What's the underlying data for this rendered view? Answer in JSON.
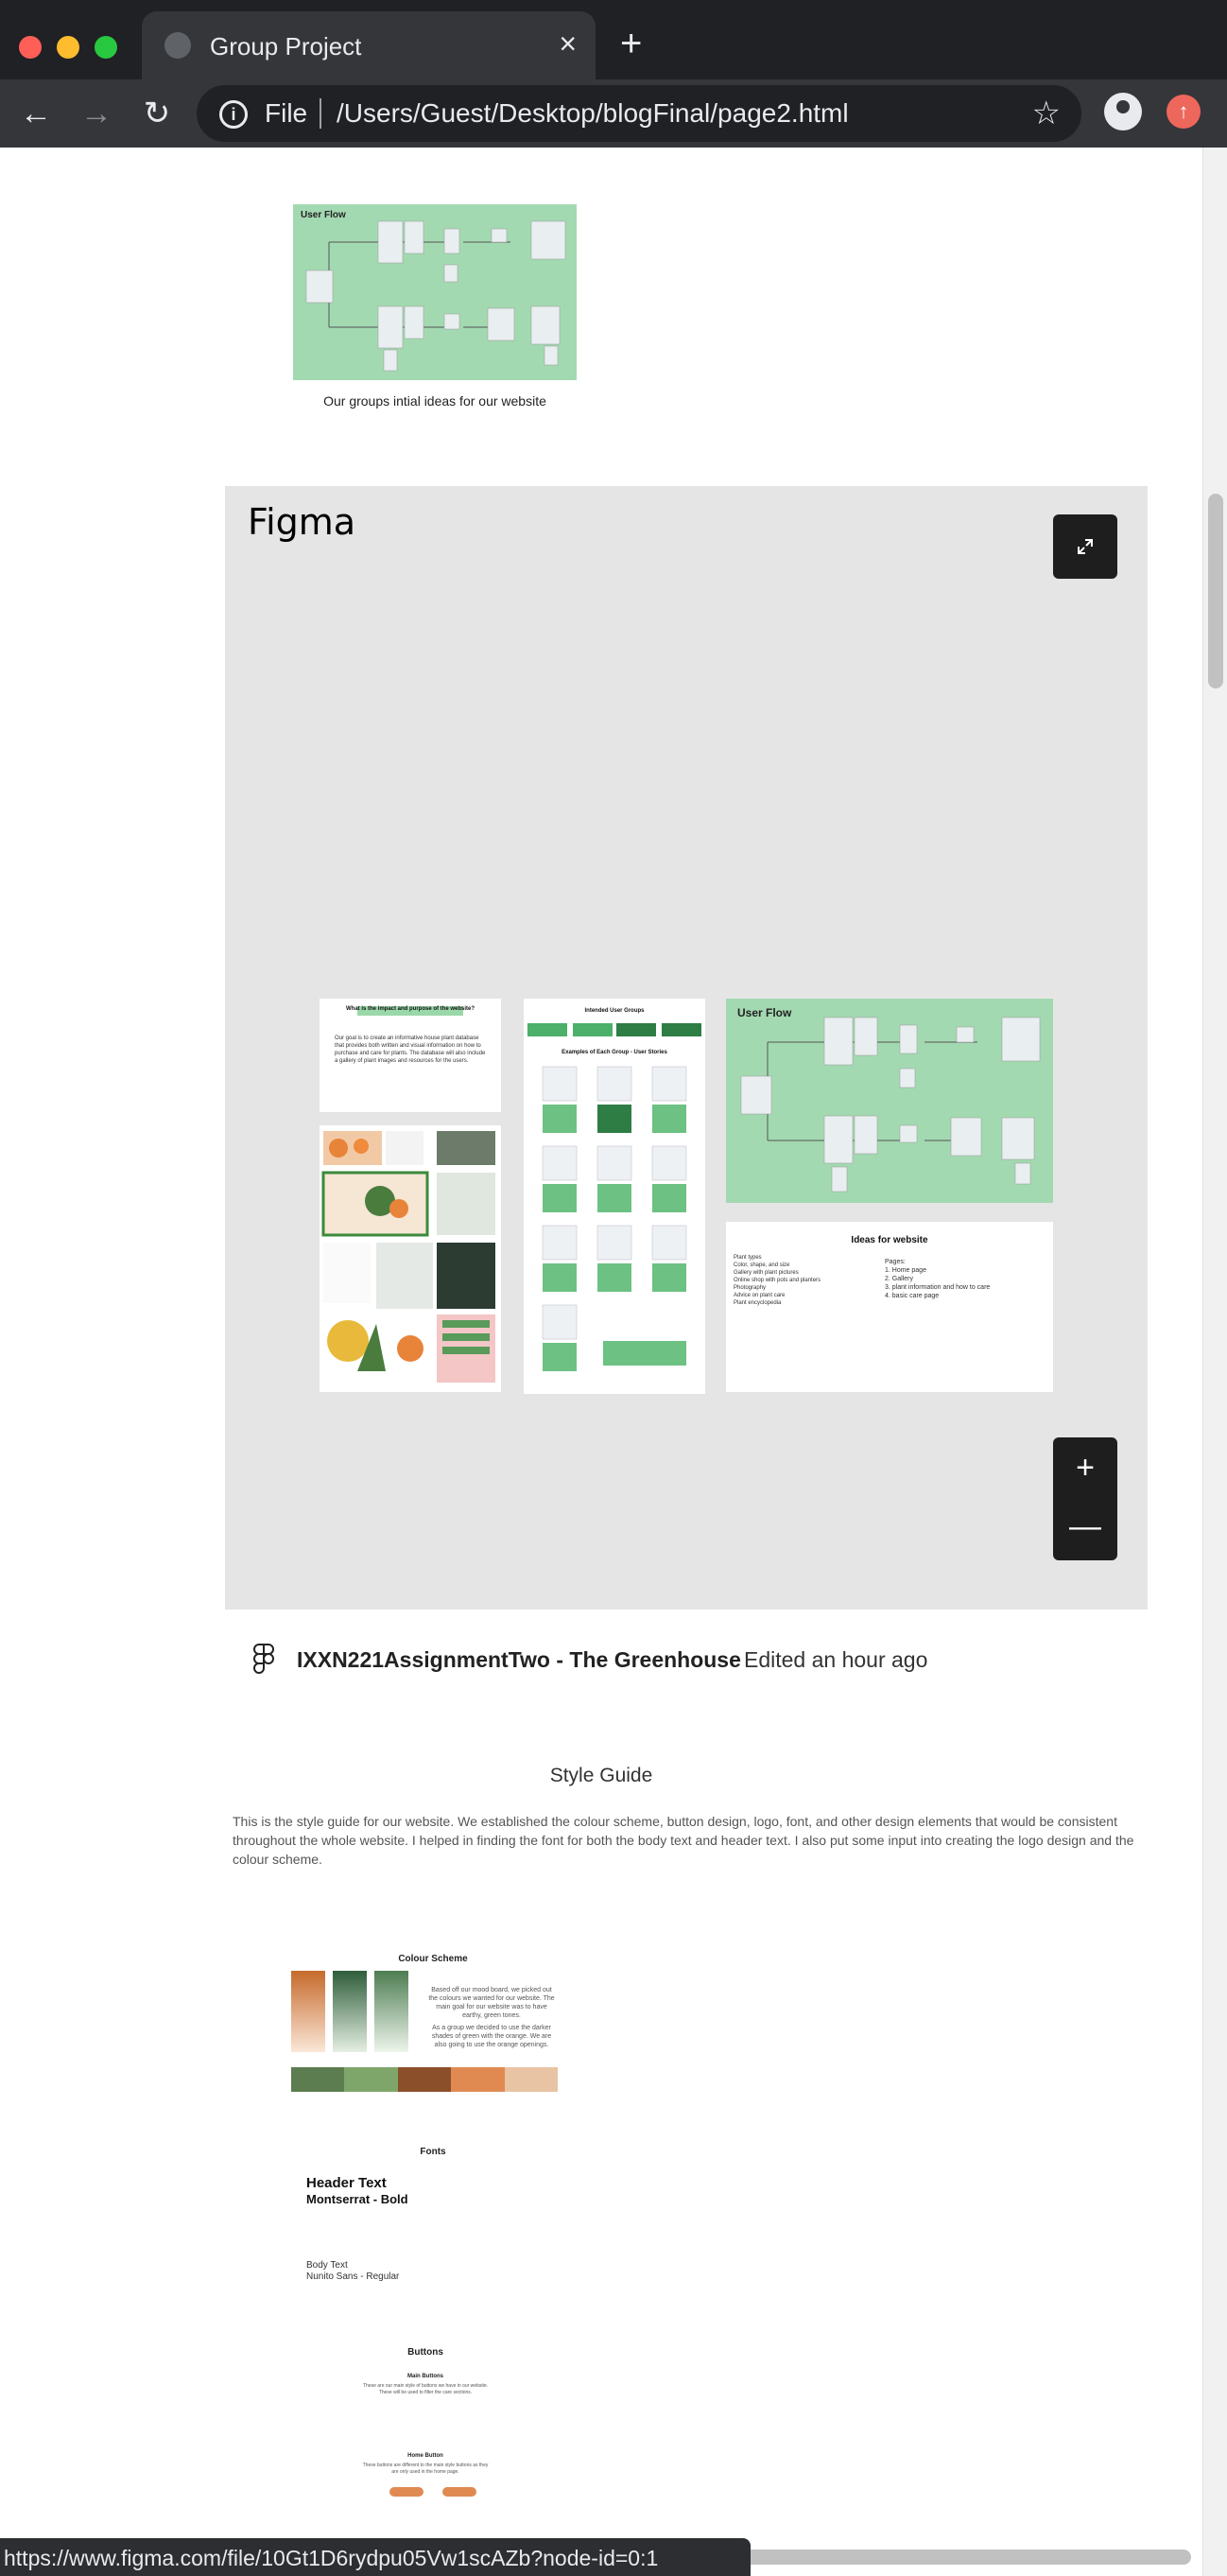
{
  "browser": {
    "tab_title": "Group Project",
    "close_tab_glyph": "×",
    "new_tab_glyph": "+",
    "back_glyph": "←",
    "forward_glyph": "→",
    "reload_glyph": "↻",
    "info_glyph": "i",
    "scheme_label": "File",
    "url": "/Users/Guest/Desktop/blogFinal/page2.html",
    "bookmark_glyph": "☆",
    "update_glyph": "↑",
    "traffic_colors": [
      "#ff5f57",
      "#febc2e",
      "#28c840"
    ]
  },
  "page": {
    "flow_image": {
      "title": "User Flow",
      "caption": "Our groups intial ideas for our website"
    },
    "figma_embed": {
      "logo": "Figma",
      "zoom_in": "+",
      "zoom_out": "—",
      "frames": {
        "purpose_title": "What is the impact and purpose of the website?",
        "purpose_body": "Our goal is to create an informative house plant database that provides both written and visual information on how to purchase and care for plants. The database will also include a gallery of plant images and resources for the users.",
        "user_groups_title": "Intended User Groups",
        "user_groups_subtitle": "Examples of Each Group - User Stories",
        "flow_title": "User Flow",
        "ideas_title": "Ideas for website",
        "ideas_left": "Plant types\nColor, shape, and size\nGallery with plant pictures\nOnline shop with pots and planters\nPhotography\nAdvice on plant care\nPlant encyclopedia",
        "ideas_right": "Pages:\n1. Home page\n2. Gallery\n3. plant information and how to care\n4. basic care page"
      },
      "file_name": "IXXN221AssignmentTwo - The Greenhouse",
      "edited": "Edited an hour ago"
    },
    "style_guide": {
      "title": "Style Guide",
      "body": "This is the style guide for our website. We established the colour scheme, button design, logo, font, and other design elements that would be consistent throughout the whole website. I helped in finding the font for both the body text and header text. I also put some input into creating the logo design and the colour scheme.",
      "image": {
        "colour_heading": "Colour Scheme",
        "colour_note": "Based off our mood board, we picked out the colours we wanted for our website. The main goal for our website was to have earthy, green tones.",
        "colour_note2": "As a group we decided to use the darker shades of green with the orange. We are also going to use the orange openings.",
        "swatches": [
          "#5c7d4f",
          "#7fa66a",
          "#8b4f2a",
          "#e08a52",
          "#e8c4a4"
        ],
        "fonts_heading": "Fonts",
        "header_text_label": "Header Text",
        "header_font": "Montserrat - Bold",
        "body_text_label": "Body Text",
        "body_font": "Nunito Sans - Regular",
        "buttons_heading": "Buttons",
        "main_buttons_label": "Main Buttons",
        "main_buttons_note": "These are our main style of buttons we have in our website. These will be used to filter the care sections.",
        "home_button_label": "Home Button",
        "home_button_note": "These buttons are different to the main style buttons as they are only used in the home page."
      }
    }
  },
  "status_url": "https://www.figma.com/file/10Gt1D6rydpu05Vw1scAZb?node-id=0:1"
}
